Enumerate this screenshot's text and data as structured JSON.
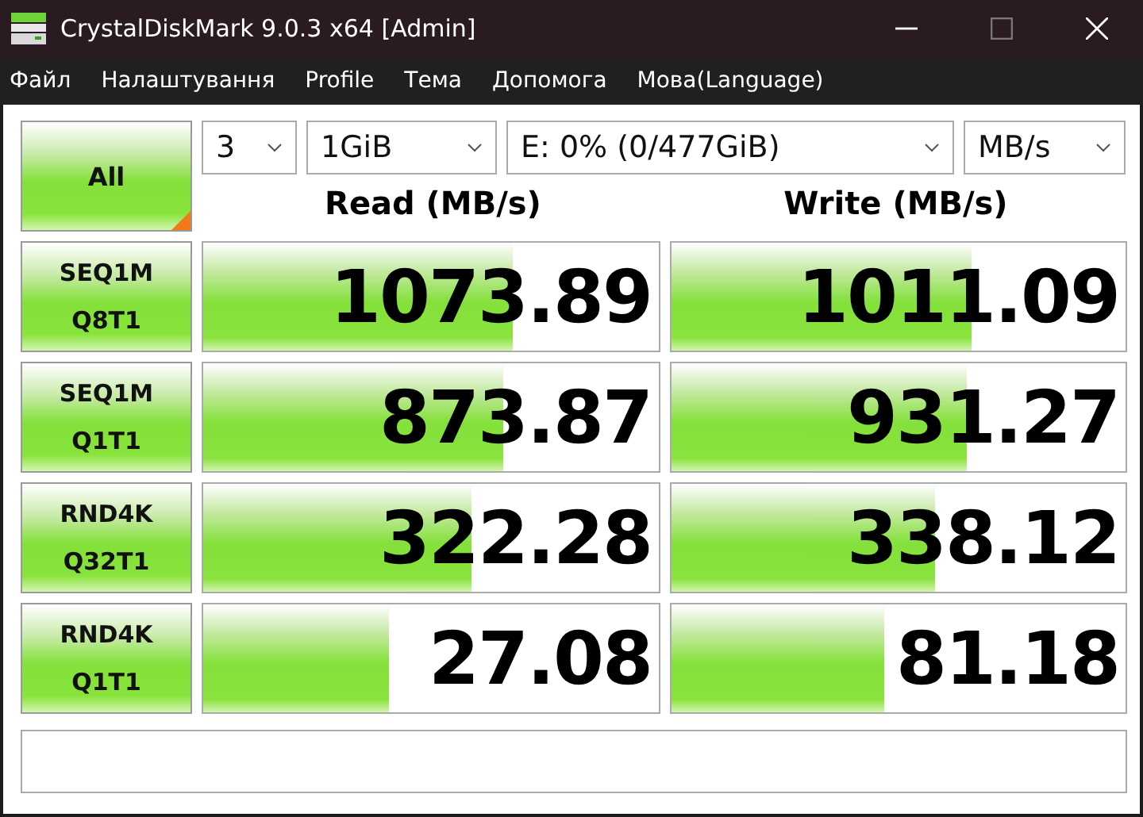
{
  "window": {
    "title": "CrystalDiskMark 9.0.3 x64 [Admin]"
  },
  "menu": [
    "Файл",
    "Налаштування",
    "Profile",
    "Тема",
    "Допомога",
    "Мова(Language)"
  ],
  "all_button": "All",
  "controls": {
    "count": "3",
    "size": "1GiB",
    "drive": "E: 0% (0/477GiB)",
    "unit": "MB/s"
  },
  "headers": {
    "read": "Read (MB/s)",
    "write": "Write (MB/s)"
  },
  "tests": [
    {
      "name": "SEQ1M",
      "params": "Q8T1",
      "read": {
        "value": "1073.89",
        "level": 0.68
      },
      "write": {
        "value": "1011.09",
        "level": 0.66
      }
    },
    {
      "name": "SEQ1M",
      "params": "Q1T1",
      "read": {
        "value": "873.87",
        "level": 0.66
      },
      "write": {
        "value": "931.27",
        "level": 0.65
      }
    },
    {
      "name": "RND4K",
      "params": "Q32T1",
      "read": {
        "value": "322.28",
        "level": 0.59
      },
      "write": {
        "value": "338.12",
        "level": 0.58
      }
    },
    {
      "name": "RND4K",
      "params": "Q1T1",
      "read": {
        "value": "27.08",
        "level": 0.41
      },
      "write": {
        "value": "81.18",
        "level": 0.47
      }
    }
  ]
}
